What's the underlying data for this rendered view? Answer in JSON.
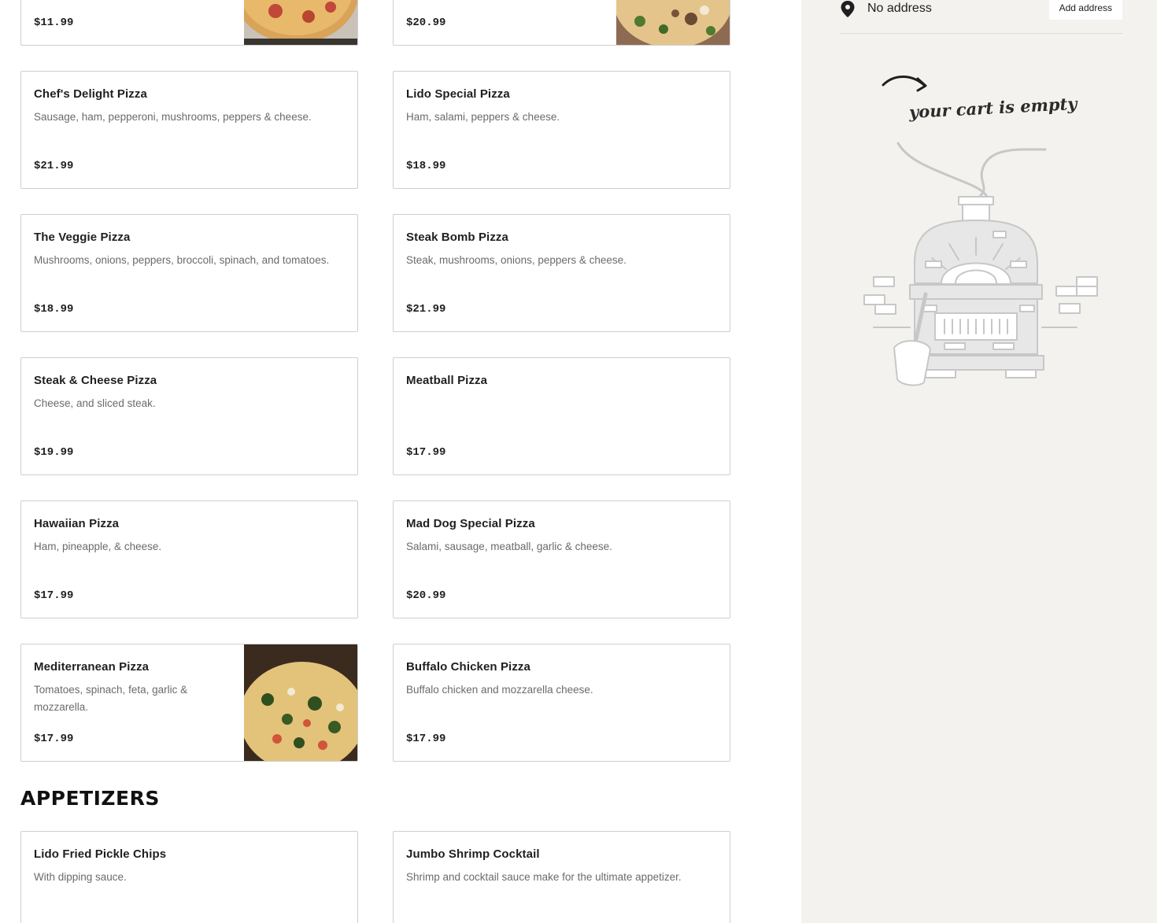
{
  "menu": {
    "pizza_items": [
      {
        "name": "",
        "desc": "",
        "price": "$11.99",
        "photo": "cheese-pizza"
      },
      {
        "name": "",
        "desc": "",
        "price": "$20.99",
        "photo": "specialty-pizza"
      },
      {
        "name": "Chef's Delight Pizza",
        "desc": "Sausage, ham, pepperoni, mushrooms, peppers & cheese.",
        "price": "$21.99"
      },
      {
        "name": "Lido Special Pizza",
        "desc": "Ham, salami, peppers & cheese.",
        "price": "$18.99"
      },
      {
        "name": "The Veggie Pizza",
        "desc": "Mushrooms, onions, peppers, broccoli, spinach, and tomatoes.",
        "price": "$18.99"
      },
      {
        "name": "Steak Bomb Pizza",
        "desc": "Steak, mushrooms, onions, peppers & cheese.",
        "price": "$21.99"
      },
      {
        "name": "Steak & Cheese Pizza",
        "desc": "Cheese, and sliced steak.",
        "price": "$19.99"
      },
      {
        "name": "Meatball Pizza",
        "desc": "",
        "price": "$17.99"
      },
      {
        "name": "Hawaiian Pizza",
        "desc": "Ham, pineapple, & cheese.",
        "price": "$17.99"
      },
      {
        "name": "Mad Dog Special Pizza",
        "desc": "Salami, sausage, meatball, garlic & cheese.",
        "price": "$20.99"
      },
      {
        "name": "Mediterranean Pizza",
        "desc": "Tomatoes, spinach, feta, garlic & mozzarella.",
        "price": "$17.99",
        "photo": "mediterranean-pizza"
      },
      {
        "name": "Buffalo Chicken Pizza",
        "desc": "Buffalo chicken and mozzarella cheese.",
        "price": "$17.99"
      }
    ],
    "appetizers_title": "APPETIZERS",
    "appetizer_items": [
      {
        "name": "Lido Fried Pickle Chips",
        "desc": "With dipping sauce.",
        "price": ""
      },
      {
        "name": "Jumbo Shrimp Cocktail",
        "desc": "Shrimp and cocktail sauce make for the ultimate appetizer.",
        "price": ""
      }
    ]
  },
  "cart": {
    "address_text": "No address",
    "add_address_label": "Add address",
    "empty_message": "your cart is empty",
    "address_icon": "map-pin-icon",
    "illustration": "pizza-oven-illustration"
  },
  "colors": {
    "sidebar_bg": "#f3f2ef",
    "card_border": "#cfcfcf",
    "text_primary": "#1f1f1f",
    "text_secondary": "#6b6b6b"
  }
}
